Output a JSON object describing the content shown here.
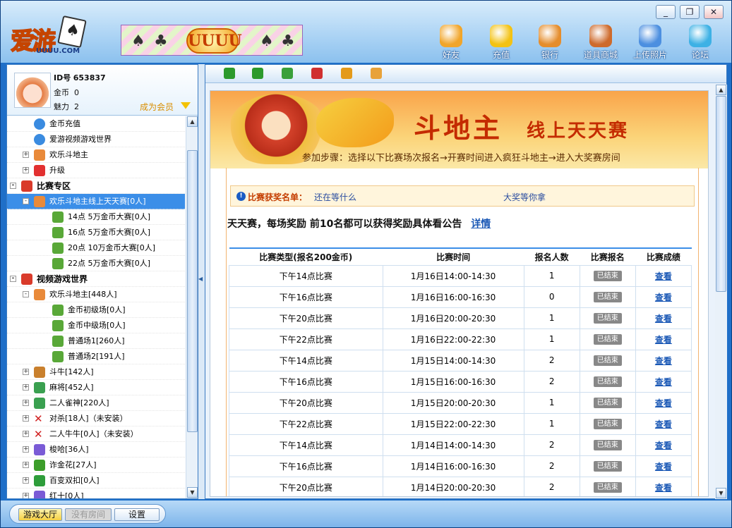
{
  "window": {
    "minimize": "_",
    "restore": "❐",
    "close": "✕"
  },
  "brand": {
    "logo_text": "爱游",
    "logo_url": "UUUU.COM",
    "banner_text": "UUUU"
  },
  "toolbar": [
    {
      "label": "好友",
      "icon": "friends-icon",
      "color": "#f1a52a"
    },
    {
      "label": "充值",
      "icon": "coin-recharge-icon",
      "color": "#f3c214"
    },
    {
      "label": "银行",
      "icon": "bank-icon",
      "color": "#e58d2c"
    },
    {
      "label": "道具商城",
      "icon": "shopping-cart-icon",
      "color": "#ce6a2b"
    },
    {
      "label": "上传照片",
      "icon": "upload-photo-icon",
      "color": "#4c8fe0"
    },
    {
      "label": "论坛",
      "icon": "forum-bubble-icon",
      "color": "#3db1e5"
    }
  ],
  "profile": {
    "id_label": "ID号",
    "id": "653837",
    "gold_label": "金币",
    "gold": "0",
    "charm_label": "魅力",
    "charm": "2",
    "member": "成为会员"
  },
  "tree": [
    {
      "text": "金币充值",
      "indent": 44,
      "expand": "",
      "icon": "ie",
      "sel": false,
      "hdr": false
    },
    {
      "text": "爱游视频游戏世界",
      "indent": 44,
      "expand": "",
      "icon": "ie",
      "sel": false,
      "hdr": false
    },
    {
      "text": "欢乐斗地主",
      "indent": 44,
      "expand": "+",
      "icon": "face",
      "sel": false,
      "hdr": false
    },
    {
      "text": "升级",
      "indent": 44,
      "expand": "+",
      "icon": "heart",
      "sel": false,
      "hdr": false
    },
    {
      "text": "比赛专区",
      "indent": 26,
      "expand": "-",
      "icon": "trophy",
      "sel": false,
      "hdr": true
    },
    {
      "text": "欢乐斗地主线上天天赛[0人]",
      "indent": 44,
      "expand": "-",
      "icon": "face",
      "sel": true,
      "hdr": false
    },
    {
      "text": "14点 5万金币大赛[0人]",
      "indent": 70,
      "expand": "",
      "icon": "house",
      "sel": false,
      "hdr": false
    },
    {
      "text": "16点  5万金币大赛[0人]",
      "indent": 70,
      "expand": "",
      "icon": "house",
      "sel": false,
      "hdr": false
    },
    {
      "text": "20点   10万金币大赛[0人]",
      "indent": 70,
      "expand": "",
      "icon": "house",
      "sel": false,
      "hdr": false
    },
    {
      "text": "22点   5万金币大赛[0人]",
      "indent": 70,
      "expand": "",
      "icon": "house",
      "sel": false,
      "hdr": false
    },
    {
      "text": "视频游戏世界",
      "indent": 26,
      "expand": "-",
      "icon": "trophy",
      "sel": false,
      "hdr": true
    },
    {
      "text": "欢乐斗地主[448人]",
      "indent": 44,
      "expand": "-",
      "icon": "face",
      "sel": false,
      "hdr": false
    },
    {
      "text": "金币初级场[0人]",
      "indent": 70,
      "expand": "",
      "icon": "house",
      "sel": false,
      "hdr": false
    },
    {
      "text": "金币中级场[0人]",
      "indent": 70,
      "expand": "",
      "icon": "house",
      "sel": false,
      "hdr": false
    },
    {
      "text": "普通场1[260人]",
      "indent": 70,
      "expand": "",
      "icon": "house",
      "sel": false,
      "hdr": false
    },
    {
      "text": "普通场2[191人]",
      "indent": 70,
      "expand": "",
      "icon": "house",
      "sel": false,
      "hdr": false
    },
    {
      "text": "斗牛[142人]",
      "indent": 44,
      "expand": "+",
      "icon": "bull",
      "sel": false,
      "hdr": false
    },
    {
      "text": "麻将[452人]",
      "indent": 44,
      "expand": "+",
      "icon": "mahjong",
      "sel": false,
      "hdr": false
    },
    {
      "text": "二人雀神[220人]",
      "indent": 44,
      "expand": "+",
      "icon": "mahjong",
      "sel": false,
      "hdr": false
    },
    {
      "text": "对杀[18人]（未安装）",
      "indent": 44,
      "expand": "+",
      "icon": "cross",
      "sel": false,
      "hdr": false
    },
    {
      "text": "二人牛牛[0人]（未安装）",
      "indent": 44,
      "expand": "+",
      "icon": "cross",
      "sel": false,
      "hdr": false
    },
    {
      "text": "梭哈[36人]",
      "indent": 44,
      "expand": "+",
      "icon": "cards",
      "sel": false,
      "hdr": false
    },
    {
      "text": "诈金花[27人]",
      "indent": 44,
      "expand": "+",
      "icon": "flower",
      "sel": false,
      "hdr": false
    },
    {
      "text": "百变双扣[0人]",
      "indent": 44,
      "expand": "+",
      "icon": "double",
      "sel": false,
      "hdr": false
    },
    {
      "text": "红十[0人]",
      "indent": 44,
      "expand": "+",
      "icon": "cards",
      "sel": false,
      "hdr": false
    }
  ],
  "icon_colors": {
    "ie": "#3a8be0",
    "face": "#e98a3a",
    "heart": "#e23030",
    "trophy": "#d93a2a",
    "house": "#59a838",
    "bull": "#c9802d",
    "mahjong": "#3aa050",
    "cross": "#d02020",
    "cards": "#7a5bd6",
    "flower": "#3c9d2a",
    "double": "#2e9d3a"
  },
  "navbar": [
    {
      "icon": "back-arrow-icon",
      "color": "#2c9a2c"
    },
    {
      "icon": "forward-arrow-icon",
      "color": "#2c9a2c"
    },
    {
      "icon": "refresh-icon",
      "color": "#3aa03a"
    },
    {
      "icon": "stop-icon",
      "color": "#d03030"
    },
    {
      "icon": "home-icon",
      "color": "#e49a1a"
    },
    {
      "icon": "favorite-icon",
      "color": "#e8a23a"
    }
  ],
  "hero": {
    "title_big": "斗地主",
    "title_small": "线上天天赛",
    "steps": "参加步骤：选择以下比赛场次报名→开赛时间进入疯狂斗地主→进入大奖赛房间"
  },
  "notice": {
    "label": "比赛获奖名单：",
    "text1": "还在等什么",
    "text2": "大奖等你拿"
  },
  "intro": {
    "text": "天天赛，每场奖励  前10名都可以获得奖励具体看公告",
    "link": "详情"
  },
  "table": {
    "headers": [
      "比赛类型(报名200金币)",
      "比赛时间",
      "报名人数",
      "比赛报名",
      "比赛成绩"
    ],
    "rows": [
      {
        "type": "下午14点比赛",
        "time": "1月16日14:00-14:30",
        "count": "1",
        "status": "已结束",
        "result": "查看"
      },
      {
        "type": "下午16点比赛",
        "time": "1月16日16:00-16:30",
        "count": "0",
        "status": "已结束",
        "result": "查看"
      },
      {
        "type": "下午20点比赛",
        "time": "1月16日20:00-20:30",
        "count": "1",
        "status": "已结束",
        "result": "查看"
      },
      {
        "type": "下午22点比赛",
        "time": "1月16日22:00-22:30",
        "count": "1",
        "status": "已结束",
        "result": "查看"
      },
      {
        "type": "下午14点比赛",
        "time": "1月15日14:00-14:30",
        "count": "2",
        "status": "已结束",
        "result": "查看"
      },
      {
        "type": "下午16点比赛",
        "time": "1月15日16:00-16:30",
        "count": "2",
        "status": "已结束",
        "result": "查看"
      },
      {
        "type": "下午20点比赛",
        "time": "1月15日20:00-20:30",
        "count": "1",
        "status": "已结束",
        "result": "查看"
      },
      {
        "type": "下午22点比赛",
        "time": "1月15日22:00-22:30",
        "count": "1",
        "status": "已结束",
        "result": "查看"
      },
      {
        "type": "下午14点比赛",
        "time": "1月14日14:00-14:30",
        "count": "2",
        "status": "已结束",
        "result": "查看"
      },
      {
        "type": "下午16点比赛",
        "time": "1月14日16:00-16:30",
        "count": "2",
        "status": "已结束",
        "result": "查看"
      },
      {
        "type": "下午20点比赛",
        "time": "1月14日20:00-20:30",
        "count": "2",
        "status": "已结束",
        "result": "查看"
      }
    ]
  },
  "bottom_tabs": [
    {
      "label": "游戏大厅",
      "state": "active"
    },
    {
      "label": "没有房间",
      "state": "disabled"
    },
    {
      "label": "设置",
      "state": "normal"
    }
  ]
}
